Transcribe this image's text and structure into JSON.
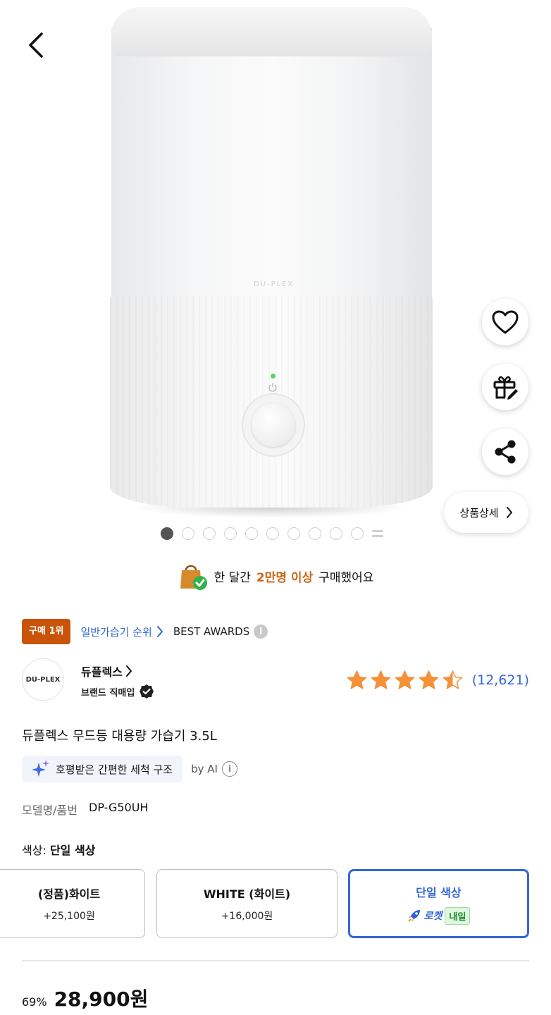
{
  "header": {
    "back_icon": "chevron-left-icon"
  },
  "product_image": {
    "brand_mark": "DU-PLEX"
  },
  "side_actions": {
    "wishlist_icon": "heart-icon",
    "gift_icon": "gift-icon",
    "share_icon": "share-icon",
    "detail_label": "상품상세"
  },
  "carousel": {
    "count": 10,
    "active_index": 0
  },
  "purchase_banner": {
    "prefix": "한 달간",
    "highlight": "2만명 이상",
    "suffix": "구매했어요"
  },
  "badges": {
    "rank_badge": "구매 1위",
    "rank_link": "일반가습기 순위",
    "awards": "BEST AWARDS"
  },
  "brand": {
    "logo_text": "DU-PLEX",
    "name": "듀플렉스",
    "sub": "브랜드 직매입"
  },
  "rating": {
    "stars": 4.5,
    "count": "(12,621)"
  },
  "title": "듀플렉스 무드등 대용량 가습기 3.5L",
  "ai_summary": {
    "chip": "호평받은 간편한 세척 구조",
    "by": "by AI"
  },
  "model": {
    "label": "모델명/품번",
    "value": "DP-G50UH"
  },
  "color": {
    "label": "색상:",
    "selected": "단일 색상"
  },
  "options": [
    {
      "name": "(정품)화이트",
      "price": "+25,100원"
    },
    {
      "name": "WHITE (화이트)",
      "price": "+16,000원"
    },
    {
      "name": "단일 색상",
      "rocket": "로켓",
      "delivery": "내일"
    }
  ],
  "price": {
    "discount": "69%",
    "final": "28,900원"
  },
  "colors": {
    "accent_blue": "#3467d6",
    "rank_orange": "#c95309",
    "star_orange": "#f5913a"
  }
}
